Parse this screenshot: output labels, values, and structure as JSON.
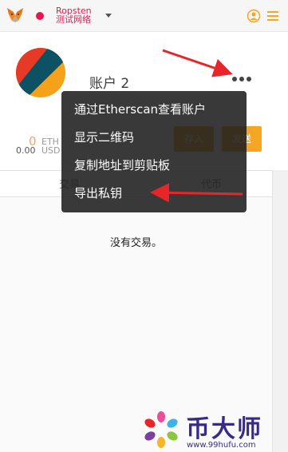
{
  "header": {
    "network_name": "Ropsten",
    "network_sub": "测试网络",
    "network_dot_color": "#e91550",
    "icons": [
      "metamask-fox-icon",
      "chevron-down-icon",
      "account-switch-icon",
      "hamburger-menu-icon"
    ]
  },
  "account": {
    "name": "账户 2",
    "balance": {
      "eth_value": "0",
      "eth_unit": "ETH",
      "usd_value": "0.00",
      "usd_unit": "USD"
    },
    "deposit_label": "存入",
    "send_label": "发送"
  },
  "tabs": [
    {
      "label": "交易"
    },
    {
      "label": "代币"
    }
  ],
  "empty_message": "没有交易。",
  "context_menu": {
    "items": [
      {
        "label": "通过Etherscan查看账户"
      },
      {
        "label": "显示二维码"
      },
      {
        "label": "复制地址到剪贴板"
      },
      {
        "label": "导出私钥"
      }
    ]
  },
  "watermark": {
    "title": "币大师",
    "url": "www.99hufu.com"
  },
  "colors": {
    "accent": "#f5a623",
    "annotation_arrow": "#e8262a"
  }
}
